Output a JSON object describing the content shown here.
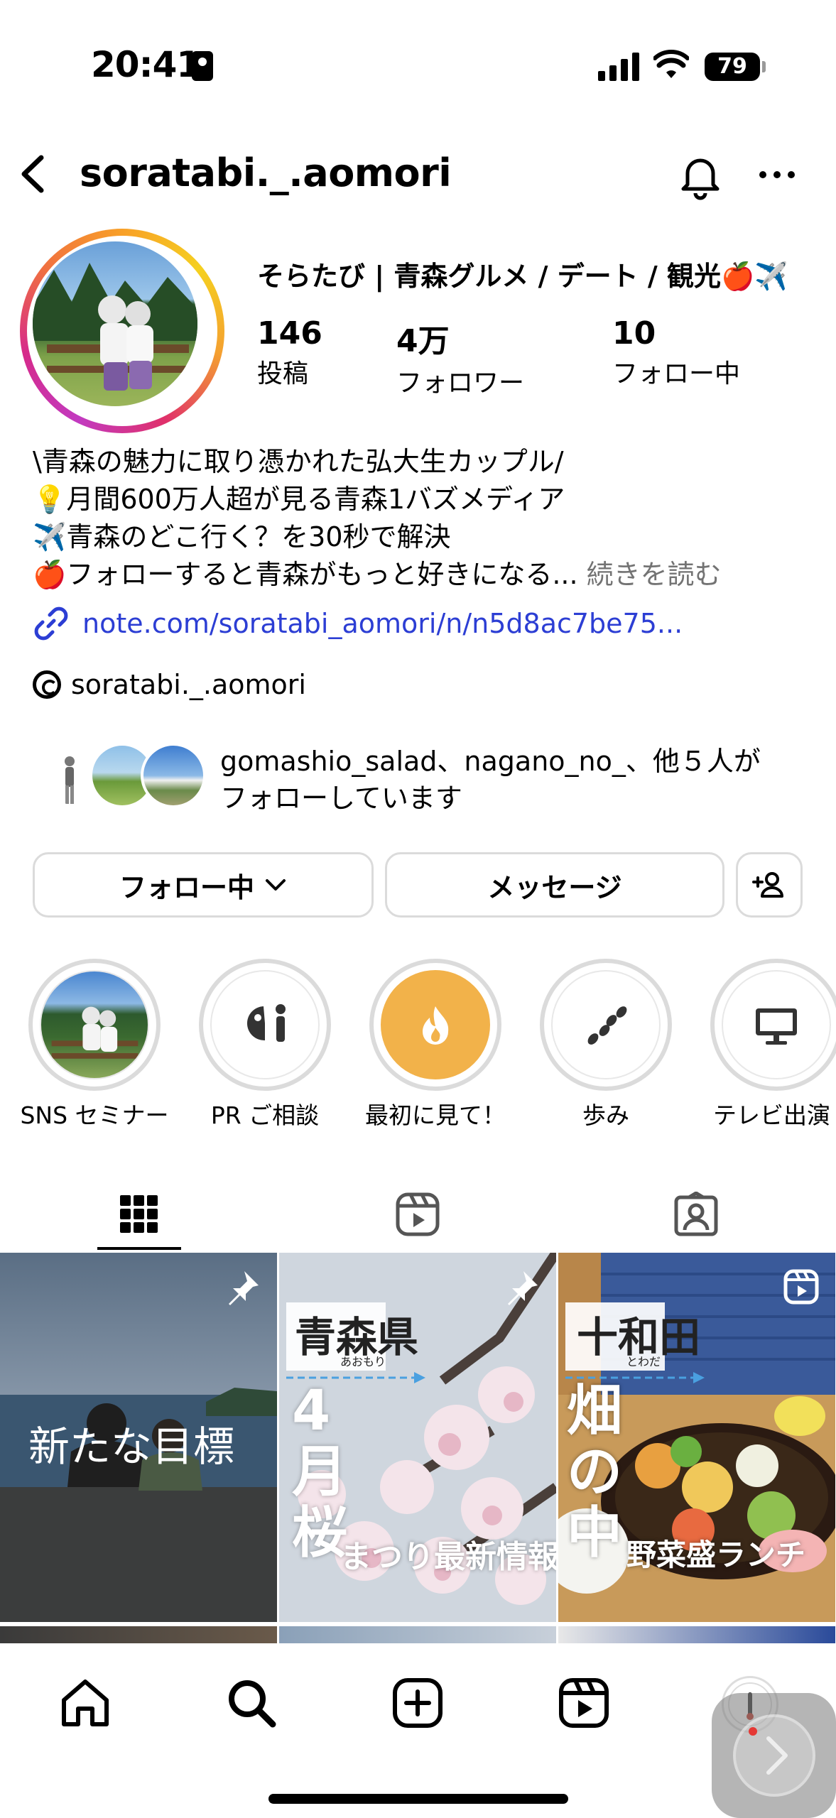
{
  "status_bar": {
    "time": "20:41",
    "battery": "79"
  },
  "header": {
    "username": "soratabi._.aomori"
  },
  "profile": {
    "display_name": "そらたび | 青森グルメ / デート / 観光🍎✈️",
    "stats": [
      {
        "num": "146",
        "label": "投稿"
      },
      {
        "num": "4万",
        "label": "フォロワー"
      },
      {
        "num": "10",
        "label": "フォロー中"
      }
    ],
    "bio": [
      "\\青森の魅力に取り憑かれた弘大生カップル/",
      "💡月間600万人超が見る青森1バズメディア",
      "✈️青森のどこ行く？を30秒で解決",
      "🍎フォローすると青森がもっと好きになる..."
    ],
    "bio_more": "続きを読む",
    "link": "note.com/soratabi_aomori/n/n5d8ac7be75...",
    "threads": "soratabi._.aomori",
    "followed_by_line1": "gomashio_salad、nagano_no_、他５人が",
    "followed_by_line2": "フォローしています"
  },
  "buttons": {
    "following": "フォロー中",
    "message": "メッセージ"
  },
  "highlights": [
    {
      "label": "SNS セミナー",
      "icon": "photo"
    },
    {
      "label": "PR ご相談",
      "icon": "pr-icon"
    },
    {
      "label": "最初に見て！",
      "icon": "flame-icon"
    },
    {
      "label": "歩み",
      "icon": "footsteps-icon"
    },
    {
      "label": "テレビ出演",
      "icon": "tv-icon"
    }
  ],
  "posts": [
    {
      "text": "新たな目標"
    },
    {
      "title": "青森県",
      "ruby": "あおもり",
      "big1": "4",
      "big2": "月",
      "big3": "桜",
      "sub": "まつり最新情報"
    },
    {
      "title": "十和田",
      "ruby": "とわだ",
      "big1": "畑",
      "big2": "の",
      "big3": "中",
      "sub": "野菜盛ランチ"
    }
  ],
  "colors": {
    "link": "#2c3ed4",
    "highlight_flame": "#f2b24a",
    "muted": "#737373"
  }
}
